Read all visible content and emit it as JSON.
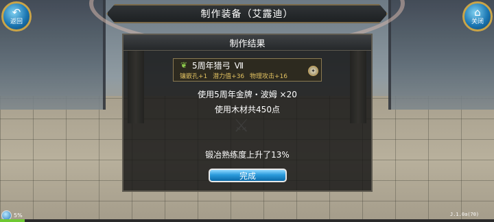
{
  "window": {
    "title": "制作装备（艾露迪）"
  },
  "nav": {
    "back_label": "返回",
    "close_label": "关闭"
  },
  "result_panel": {
    "header": "制作结果",
    "item": {
      "name": "5周年猎弓",
      "tier": "Ⅶ",
      "stats": [
        "镶嵌孔+1",
        "潜力值+36",
        "物理攻击+16"
      ],
      "icon": "leaf-icon",
      "badge_icon": "gear-badge-icon"
    },
    "line_1": "使用5周年金牌・波姆 ×20",
    "line_2": "使用木材共450点",
    "line_3": "锻冶熟练度上升了13%",
    "done_label": "完成"
  },
  "status": {
    "percent_text": "5%",
    "progress_fraction": 0.05,
    "version": "J.1.0a(70)"
  },
  "colors": {
    "accent_blue": "#2b9bdc",
    "stat_gold": "#e0c060",
    "progress_green": "#6ec832"
  }
}
